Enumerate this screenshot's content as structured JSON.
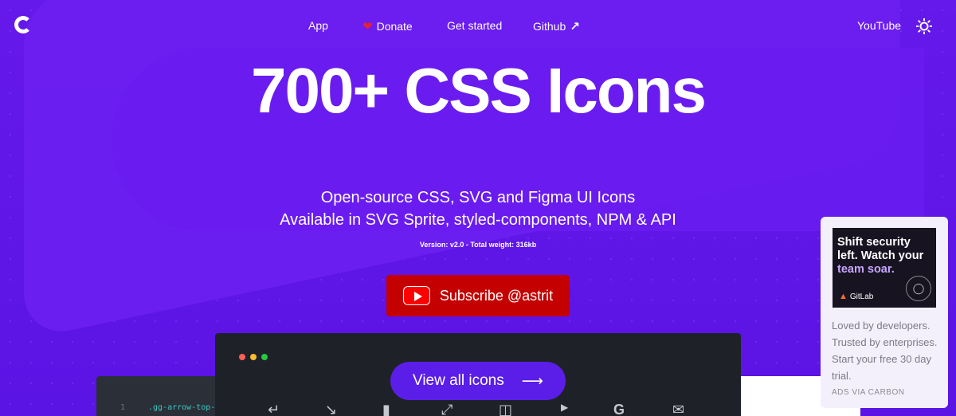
{
  "nav": {
    "app": "App",
    "donate": "Donate",
    "get_started": "Get started",
    "github": "Github",
    "youtube": "YouTube"
  },
  "hero": {
    "title": "700+ CSS Icons",
    "subtitle_line1": "Open-source CSS, SVG and Figma UI Icons",
    "subtitle_line2": "Available in SVG Sprite, styled-components, NPM & API",
    "version": "Version: v2.0 - Total weight: 316kb",
    "subscribe": "Subscribe @astrit"
  },
  "window": {
    "view_all": "View all icons",
    "code_line_number": "1",
    "code_line_text": ".gg-arrow-top-"
  },
  "ad": {
    "headline_part1": "Shift security left. Watch your ",
    "headline_highlight": "team soar.",
    "brand": "GitLab",
    "body": "Loved by developers. Trusted by enterprises. Start your free 30 day trial.",
    "via": "ADS VIA CARBON"
  },
  "colors": {
    "background": "#5b14e6",
    "subscribe": "#c40000",
    "view_all": "#5b1ee8",
    "window": "#1f2129"
  }
}
